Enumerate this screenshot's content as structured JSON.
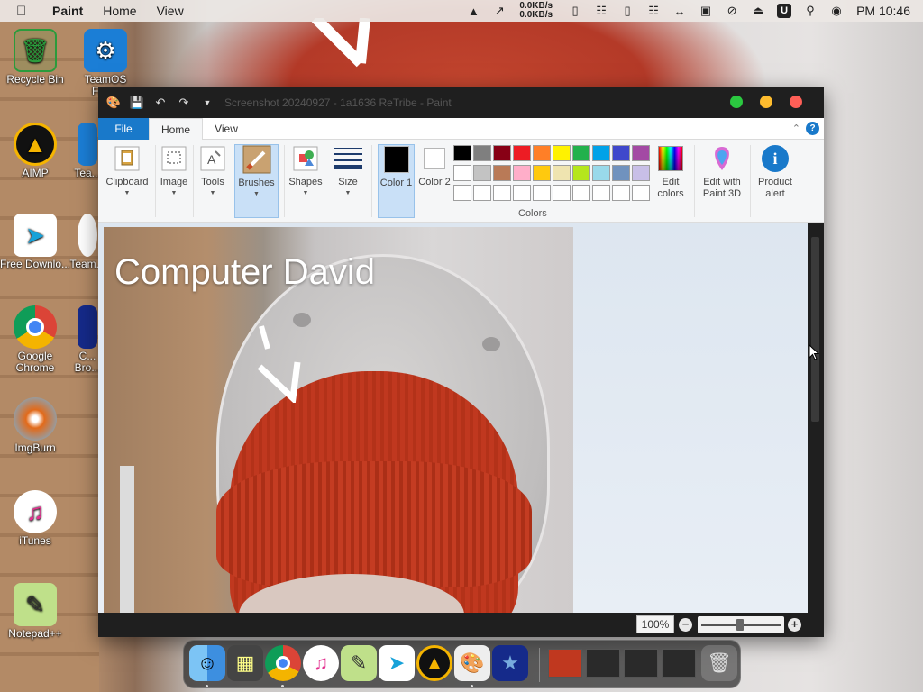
{
  "menubar": {
    "app_name": "Paint",
    "menus": [
      "Home",
      "View"
    ],
    "net_up": "0.0KB/s",
    "net_down": "0.0KB/s",
    "badge": "U",
    "clock": "PM 10:46"
  },
  "desktop_icons": [
    {
      "label": "Recycle Bin"
    },
    {
      "label": "TeamOS Fac..."
    },
    {
      "label": "AIMP"
    },
    {
      "label": "Tea..."
    },
    {
      "label": "Free Downlo..."
    },
    {
      "label": "Team..."
    },
    {
      "label": "Google Chrome"
    },
    {
      "label": "C... Bro..."
    },
    {
      "label": "ImgBurn"
    },
    {
      "label": "iTunes"
    },
    {
      "label": "Notepad++"
    }
  ],
  "window": {
    "title": "Screenshot 20240927 - 1a1636 ReTribe - Paint",
    "tabs": {
      "file": "File",
      "home": "Home",
      "view": "View"
    },
    "ribbon": {
      "clipboard": "Clipboard",
      "image": "Image",
      "tools": "Tools",
      "brushes": "Brushes",
      "shapes": "Shapes",
      "size": "Size",
      "color1": "Color 1",
      "color2": "Color 2",
      "colors_group": "Colors",
      "edit_colors": "Edit colors",
      "edit_paint3d": "Edit with Paint 3D",
      "product_alert": "Product alert"
    },
    "palette": [
      "#000000",
      "#7f7f7f",
      "#880015",
      "#ed1c24",
      "#ff7f27",
      "#fff200",
      "#22b14c",
      "#00a2e8",
      "#3f48cc",
      "#a349a4",
      "#ffffff",
      "#c3c3c3",
      "#b97a57",
      "#ffaec9",
      "#ffc90e",
      "#efe4b0",
      "#b5e61d",
      "#99d9ea",
      "#7092be",
      "#c8bfe7",
      "#ffffff",
      "#ffffff",
      "#ffffff",
      "#ffffff",
      "#ffffff",
      "#ffffff",
      "#ffffff",
      "#ffffff",
      "#ffffff",
      "#ffffff"
    ],
    "color1_value": "#000000",
    "color2_value": "#ffffff",
    "canvas_caption": "Computer David",
    "zoom": "100%"
  }
}
